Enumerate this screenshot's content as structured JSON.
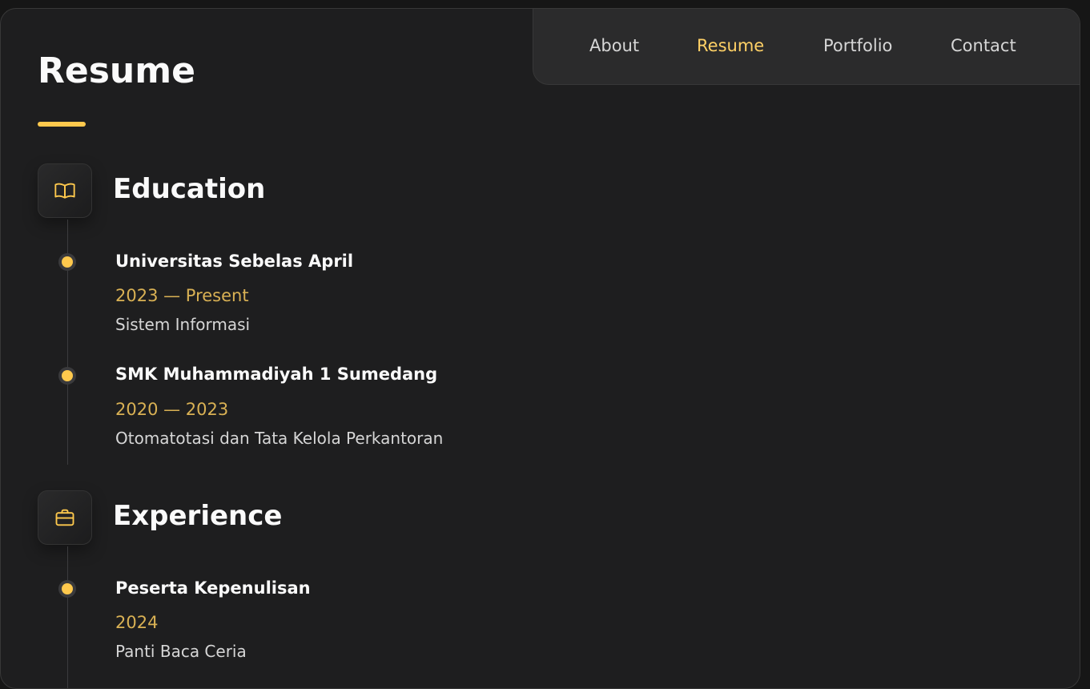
{
  "colors": {
    "accent": "#ffc94d",
    "accent_text": "#d9b154",
    "nav_active": "#ffd166",
    "background": "#1e1e1f",
    "navbar_background": "#2b2b2c",
    "text": "#fafafa",
    "muted_text": "#d6d6d6"
  },
  "nav": {
    "items": [
      {
        "label": "About",
        "active": false
      },
      {
        "label": "Resume",
        "active": true
      },
      {
        "label": "Portfolio",
        "active": false
      },
      {
        "label": "Contact",
        "active": false
      }
    ]
  },
  "page": {
    "title": "Resume"
  },
  "education": {
    "title": "Education",
    "icon": "book-open-icon",
    "items": [
      {
        "title": "Universitas Sebelas April",
        "date": "2023 — Present",
        "description": "Sistem Informasi"
      },
      {
        "title": "SMK Muhammadiyah 1 Sumedang",
        "date": "2020 — 2023",
        "description": "Otomatotasi dan Tata Kelola Perkantoran"
      }
    ]
  },
  "experience": {
    "title": "Experience",
    "icon": "briefcase-icon",
    "items": [
      {
        "title": "Peserta Kepenulisan",
        "date": "2024",
        "description": "Panti Baca Ceria"
      }
    ]
  }
}
